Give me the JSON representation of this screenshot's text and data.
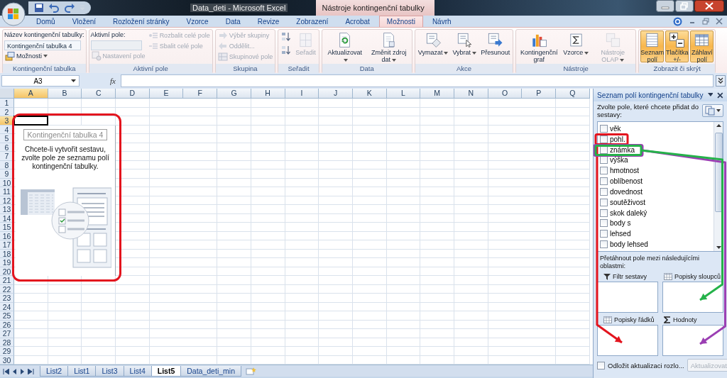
{
  "title_bar": {
    "title": "Data_deti - Microsoft Excel",
    "context_title": "Nástroje kontingenční tabulky"
  },
  "ribbon_tabs": [
    {
      "label": "Domů",
      "selected": false
    },
    {
      "label": "Vložení",
      "selected": false
    },
    {
      "label": "Rozložení stránky",
      "selected": false
    },
    {
      "label": "Vzorce",
      "selected": false
    },
    {
      "label": "Data",
      "selected": false
    },
    {
      "label": "Revize",
      "selected": false
    },
    {
      "label": "Zobrazení",
      "selected": false
    },
    {
      "label": "Acrobat",
      "selected": false
    },
    {
      "label": "Možnosti",
      "selected": true
    },
    {
      "label": "Návrh",
      "selected": false
    }
  ],
  "ribbon": {
    "groups": [
      {
        "label": "Kontingenční tabulka",
        "columns": [
          [
            {
              "kind": "label",
              "text": "Název kontingenční tabulky:"
            },
            {
              "kind": "field",
              "value": "Kontingenční tabulka 4",
              "disabled": false
            },
            {
              "kind": "small",
              "label": "Možnosti",
              "dropdown": true,
              "disabled": false
            }
          ]
        ]
      },
      {
        "label": "Aktivní pole",
        "columns": [
          [
            {
              "kind": "label",
              "text": "Aktivní pole:"
            },
            {
              "kind": "field",
              "disabled": true
            },
            {
              "kind": "small",
              "label": "Nastavení pole",
              "dropdown": false,
              "disabled": true
            }
          ],
          [
            {
              "kind": "small",
              "label": "Rozbalit celé pole",
              "dropdown": false,
              "disabled": true
            },
            {
              "kind": "small",
              "label": "Sbalit celé pole",
              "dropdown": false,
              "disabled": true
            }
          ]
        ]
      },
      {
        "label": "Skupina",
        "columns": [
          [
            {
              "kind": "small",
              "label": "Výběr skupiny",
              "dropdown": false,
              "disabled": true
            },
            {
              "kind": "small",
              "label": "Oddělit...",
              "dropdown": false,
              "disabled": true
            },
            {
              "kind": "small",
              "label": "Skupinové pole",
              "dropdown": false,
              "disabled": true
            }
          ]
        ]
      },
      {
        "label": "Seřadit",
        "columns": [
          [
            {
              "kind": "icon",
              "disabled": false
            },
            {
              "kind": "icon",
              "disabled": false
            }
          ],
          [
            {
              "kind": "large",
              "label": "Seřadit",
              "dropdown": false,
              "disabled": true,
              "on": false
            }
          ]
        ]
      },
      {
        "label": "Data",
        "columns": [
          [
            {
              "kind": "large",
              "label": "Aktualizovat",
              "dropdown": true,
              "disabled": false,
              "on": false
            }
          ],
          [
            {
              "kind": "large",
              "label": "Změnit zdroj dat",
              "dropdown": true,
              "disabled": false,
              "on": false
            }
          ]
        ]
      },
      {
        "label": "Akce",
        "columns": [
          [
            {
              "kind": "large",
              "label": "Vymazat",
              "dropdown": true,
              "disabled": false,
              "on": false
            }
          ],
          [
            {
              "kind": "large",
              "label": "Vybrat",
              "dropdown": true,
              "disabled": false,
              "on": false
            }
          ],
          [
            {
              "kind": "large",
              "label": "Přesunout",
              "dropdown": false,
              "disabled": false,
              "on": false
            }
          ]
        ]
      },
      {
        "label": "Nástroje",
        "columns": [
          [
            {
              "kind": "large",
              "label": "Kontingenční graf",
              "dropdown": false,
              "disabled": false,
              "on": false
            }
          ],
          [
            {
              "kind": "large",
              "label": "Vzorce",
              "dropdown": true,
              "disabled": false,
              "on": false
            }
          ],
          [
            {
              "kind": "large",
              "label": "Nástroje OLAP",
              "dropdown": true,
              "disabled": true,
              "on": false
            }
          ]
        ]
      },
      {
        "label": "Zobrazit či skrýt",
        "columns": [
          [
            {
              "kind": "large",
              "label": "Seznam polí",
              "dropdown": false,
              "disabled": false,
              "on": true
            }
          ],
          [
            {
              "kind": "large",
              "label": "Tlačítka +/-",
              "dropdown": false,
              "disabled": false,
              "on": true
            }
          ],
          [
            {
              "kind": "large",
              "label": "Záhlaví polí",
              "dropdown": false,
              "disabled": false,
              "on": true
            }
          ]
        ]
      }
    ]
  },
  "formula_bar": {
    "name_box": "A3",
    "fx_label": "fx"
  },
  "sheet": {
    "columns": [
      {
        "label": "A",
        "selected": true
      },
      {
        "label": "B",
        "selected": false
      },
      {
        "label": "C",
        "selected": false
      },
      {
        "label": "D",
        "selected": false
      },
      {
        "label": "E",
        "selected": false
      },
      {
        "label": "F",
        "selected": false
      },
      {
        "label": "G",
        "selected": false
      },
      {
        "label": "H",
        "selected": false
      },
      {
        "label": "I",
        "selected": false
      },
      {
        "label": "J",
        "selected": false
      },
      {
        "label": "K",
        "selected": false
      },
      {
        "label": "L",
        "selected": false
      },
      {
        "label": "M",
        "selected": false
      },
      {
        "label": "N",
        "selected": false
      },
      {
        "label": "O",
        "selected": false
      },
      {
        "label": "P",
        "selected": false
      },
      {
        "label": "Q",
        "selected": false
      }
    ],
    "rows": [
      {
        "label": "1",
        "selected": false
      },
      {
        "label": "2",
        "selected": false
      },
      {
        "label": "3",
        "selected": true
      },
      {
        "label": "4",
        "selected": false
      },
      {
        "label": "5",
        "selected": false
      },
      {
        "label": "6",
        "selected": false
      },
      {
        "label": "7",
        "selected": false
      },
      {
        "label": "8",
        "selected": false
      },
      {
        "label": "9",
        "selected": false
      },
      {
        "label": "10",
        "selected": false
      },
      {
        "label": "11",
        "selected": false
      },
      {
        "label": "12",
        "selected": false
      },
      {
        "label": "13",
        "selected": false
      },
      {
        "label": "14",
        "selected": false
      },
      {
        "label": "15",
        "selected": false
      },
      {
        "label": "16",
        "selected": false
      },
      {
        "label": "17",
        "selected": false
      },
      {
        "label": "18",
        "selected": false
      },
      {
        "label": "19",
        "selected": false
      },
      {
        "label": "20",
        "selected": false
      },
      {
        "label": "21",
        "selected": false
      },
      {
        "label": "22",
        "selected": false
      },
      {
        "label": "23",
        "selected": false
      },
      {
        "label": "24",
        "selected": false
      },
      {
        "label": "25",
        "selected": false
      },
      {
        "label": "26",
        "selected": false
      },
      {
        "label": "27",
        "selected": false
      },
      {
        "label": "28",
        "selected": false
      },
      {
        "label": "29",
        "selected": false
      },
      {
        "label": "30",
        "selected": false
      }
    ]
  },
  "pivot_placeholder": {
    "title": "Kontingenční tabulka 4",
    "instruction": "Chcete-li vytvořit sestavu, zvolte pole ze seznamu polí kontingenční tabulky."
  },
  "sheet_tabs": [
    {
      "label": "List2",
      "selected": false
    },
    {
      "label": "List1",
      "selected": false
    },
    {
      "label": "List3",
      "selected": false
    },
    {
      "label": "List4",
      "selected": false
    },
    {
      "label": "List5",
      "selected": true
    },
    {
      "label": "Data_deti_min",
      "selected": false
    }
  ],
  "field_list": {
    "title": "Seznam polí kontingenční tabulky",
    "prompt": "Zvolte pole, které chcete přidat do sestavy:",
    "fields": [
      {
        "label": "věk",
        "checked": false
      },
      {
        "label": "pohl.",
        "checked": false
      },
      {
        "label": "známka",
        "checked": false
      },
      {
        "label": "výška",
        "checked": false
      },
      {
        "label": "hmotnost",
        "checked": false
      },
      {
        "label": "oblíbenost",
        "checked": false
      },
      {
        "label": "dovednost",
        "checked": false
      },
      {
        "label": "soutěživost",
        "checked": false
      },
      {
        "label": "skok daleký",
        "checked": false
      },
      {
        "label": "body s",
        "checked": false
      },
      {
        "label": "lehsed",
        "checked": false
      },
      {
        "label": "body lehsed",
        "checked": false
      }
    ],
    "drag_hint": "Přetáhnout pole mezi následujícími oblastmi:",
    "areas": [
      {
        "label": "Filtr sestavy"
      },
      {
        "label": "Popisky sloupců"
      },
      {
        "label": "Popisky řádků"
      },
      {
        "label": "Hodnoty"
      }
    ],
    "defer_update": {
      "label": "Odložit aktualizaci rozlo...",
      "checked": false
    },
    "update_button": {
      "label": "Aktualizovat",
      "disabled": true
    }
  },
  "annotations": [
    {
      "kind": "frame",
      "color": "#e3141e"
    },
    {
      "kind": "box-arrow",
      "color": "#e3141e"
    },
    {
      "kind": "box-arrow",
      "color": "#9b3fb3"
    },
    {
      "kind": "box-arrow",
      "color": "#25b24a"
    }
  ]
}
